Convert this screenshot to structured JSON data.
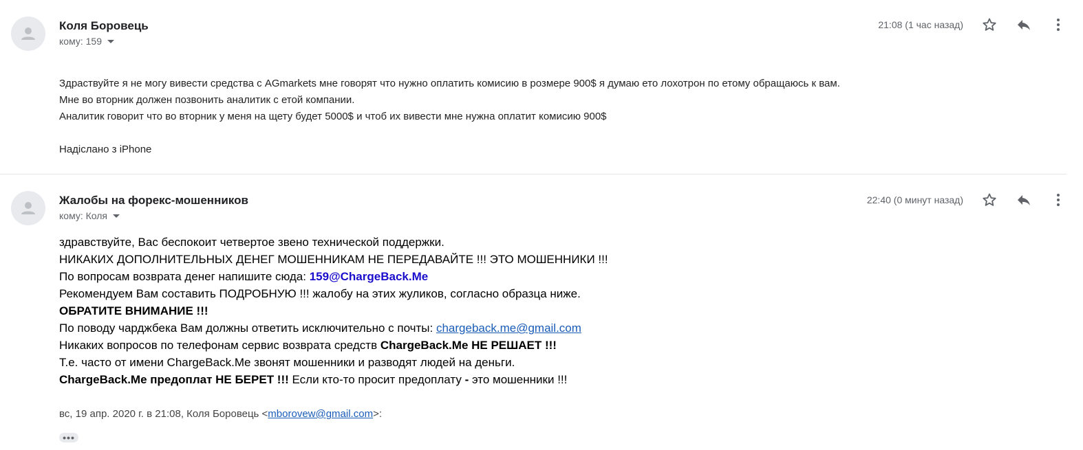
{
  "messages": [
    {
      "sender": "Коля Боровець",
      "to_label": "кому: 159",
      "time": "21:08 (1 час назад)",
      "body": [
        "Здраствуйте я не могу вивести средства с AGmarkets мне говорят что нужно оплатить комисию в розмере 900$ я думаю ето лохотрон по етому обращаюсь к вам.",
        "Мне во вторник должен позвонить аналитик с етой компании.",
        "Аналитик говорит что во вторник у меня на щету будет 5000$ и чтоб их вивести мне нужна оплатит комисию 900$"
      ],
      "signature": "Надіслано з iPhone"
    },
    {
      "sender": "Жалобы на форекс-мошенников",
      "to_label": "кому: Коля",
      "time": "22:40 (0 минут назад)",
      "lines": {
        "l1": "здравствуйте, Вас беспокоит четвертое звено технической поддержки.",
        "l2": "НИКАКИХ ДОПОЛНИТЕЛЬНЫХ ДЕНЕГ МОШЕННИКАМ НЕ ПЕРЕДАВАЙТЕ !!! ЭТО МОШЕННИКИ !!!",
        "l3_text": "По вопросам возврата денег напишите сюда: ",
        "l3_link": "159@ChargeBack.Me",
        "l4": "Рекомендуем Вам составить ПОДРОБНУЮ !!! жалобу на этих жуликов, согласно образца ниже.",
        "l5": "ОБРАТИТЕ ВНИМАНИЕ !!!",
        "l6_text": "По поводу чарджбека Вам должны ответить исключительно с почты: ",
        "l6_link": "chargeback.me@gmail.com",
        "l7_text": "Никаких вопросов по телефонам сервис возврата средств ",
        "l7_bold": "ChargeBack.Me НЕ РЕШАЕТ !!!",
        "l8": "Т.е. часто от имени ChargeBack.Me звонят мошенники и разводят людей на деньги.",
        "l9_bold": "ChargeBack.Me предоплат НЕ БЕРЕТ !!!",
        "l9_text": " Если кто-то просит предоплату ",
        "l9_dash": "-",
        "l9_tail": " это мошенники !!!"
      },
      "quote": {
        "prefix": "вс, 19 апр. 2020 г. в 21:08, Коля Боровець <",
        "email": "mborovew@gmail.com",
        "suffix": ">:"
      },
      "ellipsis": "•••"
    }
  ],
  "icons": {
    "avatar": "person-icon",
    "star": "star-icon",
    "reply": "reply-icon",
    "more": "more-vert-icon",
    "caret": "caret-down-icon"
  },
  "colors": {
    "avatar_bg": "#e8eaed",
    "avatar_fg": "#bdc1c6",
    "icon": "#5f6368",
    "link_blue": "#1a0dcc",
    "link_underline": "#1a5cb8"
  }
}
